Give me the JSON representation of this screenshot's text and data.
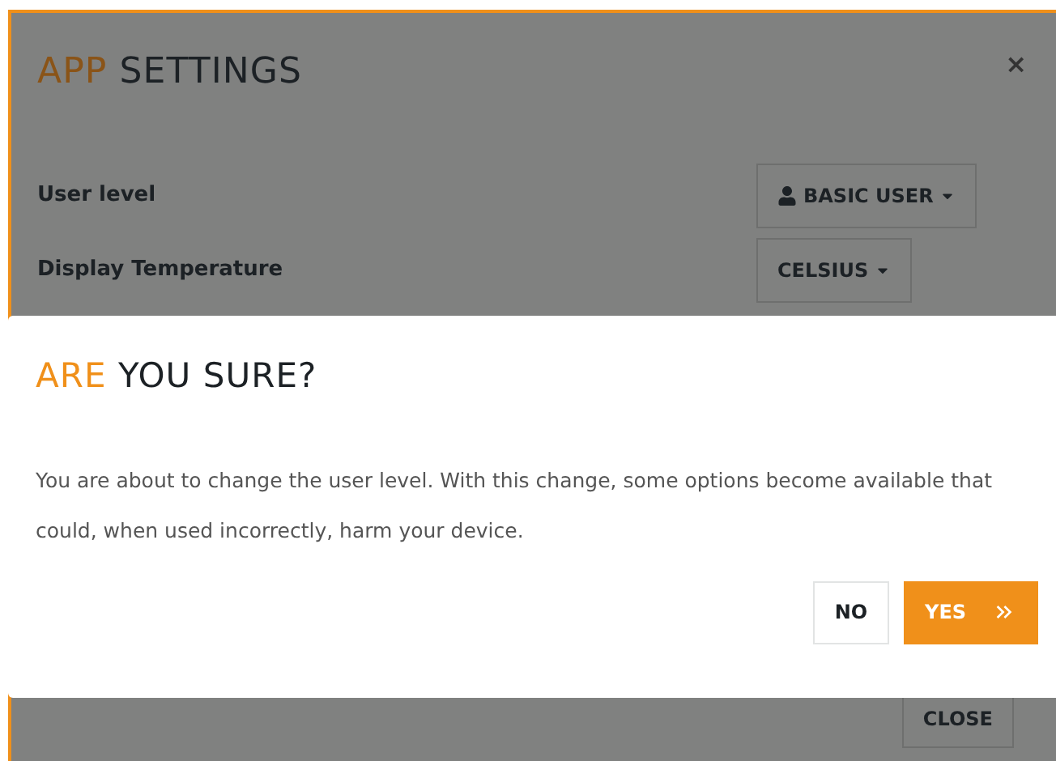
{
  "settings": {
    "title_accent": "APP",
    "title_rest": "SETTINGS",
    "close_symbol": "×",
    "rows": [
      {
        "label": "User level",
        "value": "BASIC USER",
        "kind": "person"
      },
      {
        "label": "Display Temperature",
        "value": "CELSIUS",
        "kind": "plain"
      }
    ],
    "close_button": "CLOSE"
  },
  "confirm": {
    "title_accent": "ARE",
    "title_rest": "YOU SURE?",
    "message": "You are about to change the user level. With this change, some options become available that could, when used incorrectly, harm your device.",
    "buttons": [
      {
        "label": "NO",
        "kind": "secondary"
      },
      {
        "label": "YES",
        "kind": "primary"
      }
    ]
  }
}
